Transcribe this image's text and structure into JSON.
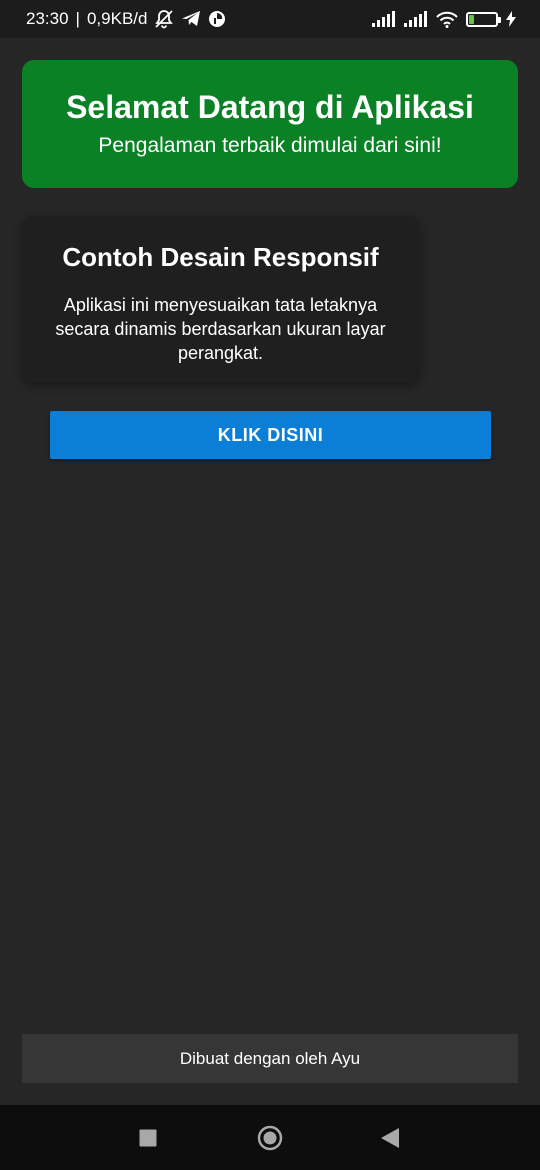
{
  "status_bar": {
    "time": "23:30",
    "separator": "|",
    "network_speed": "0,9KB/d",
    "icons_left": [
      "bell-off-icon",
      "telegram-icon",
      "app-notification-icon"
    ],
    "icons_right": [
      "signal-icon",
      "signal-icon",
      "wifi-icon",
      "battery-icon",
      "charging-icon"
    ],
    "battery_level": "25",
    "battery_fraction": 0.25,
    "battery_color": "#6ec04a"
  },
  "header": {
    "title": "Selamat Datang di Aplikasi",
    "subtitle": "Pengalaman terbaik dimulai dari sini!",
    "background_color": "#0a8125"
  },
  "card": {
    "title": "Contoh Desain Responsif",
    "body": "Aplikasi ini menyesuaikan tata letaknya secara dinamis berdasarkan ukuran layar perangkat."
  },
  "button": {
    "label": "KLIK DISINI",
    "color": "#0b7fd8"
  },
  "footer": {
    "text": "Dibuat dengan oleh Ayu"
  },
  "nav_bar": {
    "buttons": [
      "recents-icon",
      "home-icon",
      "back-icon"
    ]
  }
}
